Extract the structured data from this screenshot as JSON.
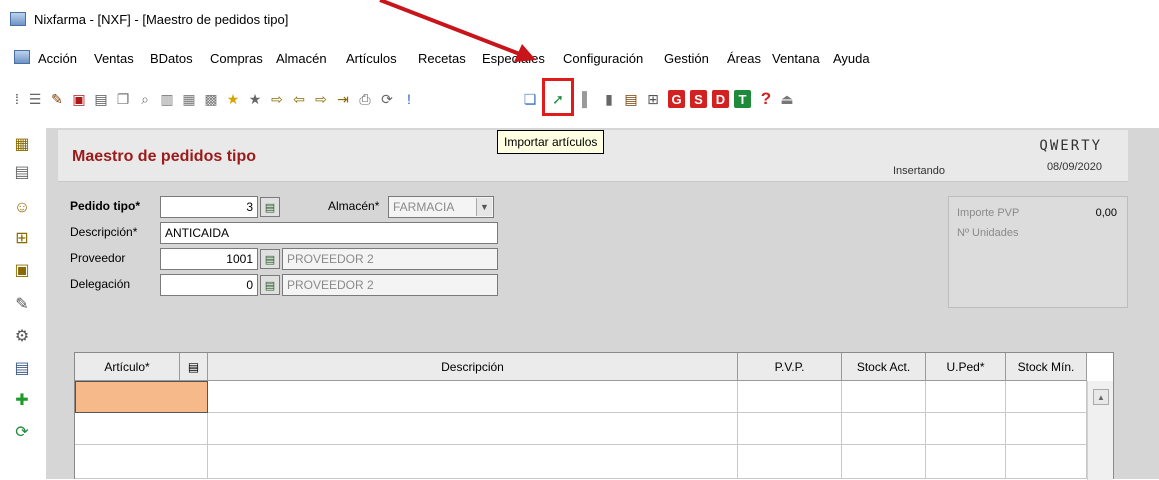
{
  "window": {
    "title": "Nixfarma - [NXF] - [Maestro de pedidos tipo]"
  },
  "menu": [
    "Acción",
    "Ventas",
    "BDatos",
    "Compras",
    "Almacén",
    "Artículos",
    "Recetas",
    "Especiales",
    "Configuración",
    "Gestión",
    "Áreas",
    "Ventana",
    "Ayuda"
  ],
  "toolbar": {
    "letters": [
      "G",
      "S",
      "D",
      "T"
    ],
    "help": "?",
    "tooltip": "Importar artículos",
    "colors": {
      "letter_bg": [
        "#d32020",
        "#d32020",
        "#d32020",
        "#1f8a3a"
      ],
      "highlight": "#e11b1b"
    }
  },
  "header": {
    "title": "Maestro de pedidos tipo",
    "company": "QWERTY",
    "date": "08/09/2020",
    "status": "Insertando"
  },
  "form": {
    "pedido_tipo_label": "Pedido tipo*",
    "pedido_tipo_value": "3",
    "almacen_label": "Almacén*",
    "almacen_value": "FARMACIA",
    "descripcion_label": "Descripción*",
    "descripcion_value": "ANTICAIDA",
    "proveedor_label": "Proveedor",
    "proveedor_code": "1001",
    "proveedor_name": "PROVEEDOR 2",
    "delegacion_label": "Delegación",
    "delegacion_code": "0",
    "delegacion_name": "PROVEEDOR 2"
  },
  "totals": {
    "importe_label": "Importe PVP",
    "importe_value": "0,00",
    "unidades_label": "Nº Unidades"
  },
  "grid": {
    "columns": [
      "Artículo*",
      "Descripción",
      "P.V.P.",
      "Stock Act.",
      "U.Ped*",
      "Stock Mín."
    ]
  }
}
